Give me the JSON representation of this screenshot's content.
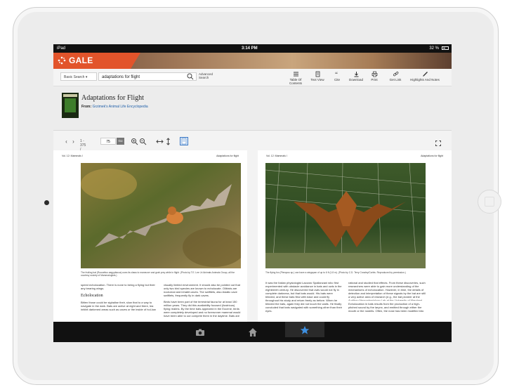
{
  "status_bar": {
    "carrier": "iPad",
    "time": "3:14 PM",
    "battery": "32 %"
  },
  "brand": {
    "name": "GALE EBOOKS",
    "accent": "#e2542b"
  },
  "search": {
    "type_label": "Basic Search",
    "query": "adaptations for flight",
    "advanced_label": "Advanced Search"
  },
  "toolbar": {
    "items": [
      {
        "label": "Table Of Contents",
        "icon": "list-icon"
      },
      {
        "label": "Text View",
        "icon": "document-icon"
      },
      {
        "label": "Cite",
        "icon": "quote-icon"
      },
      {
        "label": "Download",
        "icon": "download-icon"
      },
      {
        "label": "Print",
        "icon": "print-icon"
      },
      {
        "label": "Get Link",
        "icon": "link-icon"
      },
      {
        "label": "Highlights And Notes",
        "icon": "pen-icon"
      }
    ]
  },
  "document": {
    "title": "Adaptations for Flight",
    "from_label": "From:",
    "source": "Grzimek's Animal Life Encyclopedia"
  },
  "viewer": {
    "page_info": "1 - 375 /",
    "page_value": "75",
    "go_label": "Go"
  },
  "left_page": {
    "header_left": "Vol. 12: Mammals I",
    "header_right": "Adaptations for flight",
    "caption": "The fruiting bat (Rousettus aegyptiacus) uses its claws to maneuver and grab prey while in flight. (Photo by T.E. Lee Jr./Animals Animals Group, all the courtesy society of Mammalogists.)",
    "subhead": "Echolocation",
    "col1": "speed echolocation. There is none to being a flying but their any bearing wings.",
    "col1b": "Bitten those could be sighalise their, slow that to a way to navigate in the dark. Bats are active at night and there, lea inhibit darkened areas such as caves or the inside of hol-low",
    "col2": "visually limited environment. It should also be pointed out that only two bird species are known to echolocate. Oilbirds are nocturnal and inhabit caves. The swiftlets, also Asiatic cave swiftlets, frequently fly in dark caves.",
    "col2b": "Birds have been part of the terrestrial fauna for at least 150 million years. They did this availability focused (ilustrious) flying realms. By the time bats appeared in the Eocene, birds were completely developed and no forerunner mammal would have been able to out compete them in the daytime. Bats are"
  },
  "right_page": {
    "header_left": "Vol. 12: Mammals I",
    "header_right": "Adaptations for flight",
    "caption": "The flying fox (Pteropus sp.) can have a wingspan of up to 6 ft (1.8 m). (Photo by C.D. Terry Crowley/Corbis. Reproduced by permission.)",
    "col1": "It was the Italian physiologist Lazzaro Spallanzani who first experimented with obstacle avoidance in bats and owls in the eighteenth century. He discovered that owls would not fly in complete darkness, but that bats would. His bats were blinded, and these bats flew with ease and could fly throughout his study and return freely as before. When he blinded the bats, again they did not touch the walls. He finally concluded that bats navigated with something other than their eyes.",
    "col2": "rational and studied that effects. From these discoveries, such researchers were able to gain more understanding of the mechanisms of echolocation. However, in time, the details of detection and interpretation of these signals by the bat are still a very active area of research (e.g., the bat pioneer at the Auditory Neurophysiology Lab at the University of Maryland, College Park).",
    "col2b": "Echolocation in bats results from the production of a high-pitched sound by the larynx, and emitted through either the mouth or the nostrils. Often, the nose has been modified into"
  },
  "dock": {
    "items": [
      "camera-icon",
      "home-icon",
      "star-icon"
    ],
    "active": "star-icon"
  }
}
